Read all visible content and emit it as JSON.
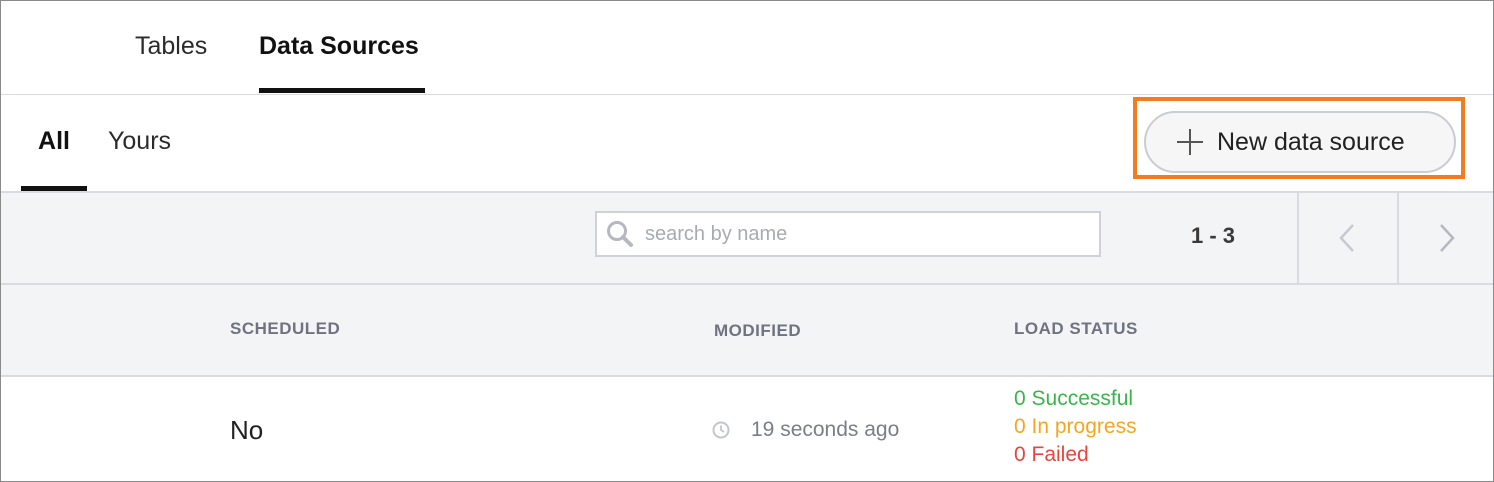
{
  "tabs": {
    "tables": "Tables",
    "data_sources": "Data Sources"
  },
  "filters": {
    "all": "All",
    "yours": "Yours"
  },
  "new_button": {
    "label": "New data source",
    "icon": "plus-icon"
  },
  "search": {
    "placeholder": "search by name",
    "value": "",
    "icon": "search-icon"
  },
  "pagination": {
    "range": "1 - 3",
    "prev_icon": "chevron-left-icon",
    "next_icon": "chevron-right-icon"
  },
  "columns": {
    "scheduled": "SCHEDULED",
    "modified": "MODIFIED",
    "load_status": "LOAD STATUS"
  },
  "rows": [
    {
      "scheduled": "No",
      "modified": "19 seconds ago",
      "load_status": {
        "successful": "0 Successful",
        "in_progress": "0 In progress",
        "failed": "0 Failed"
      }
    }
  ],
  "colors": {
    "highlight": "#f47c20",
    "successful": "#3ab54a",
    "in_progress": "#f5a623",
    "failed": "#e8453c"
  }
}
